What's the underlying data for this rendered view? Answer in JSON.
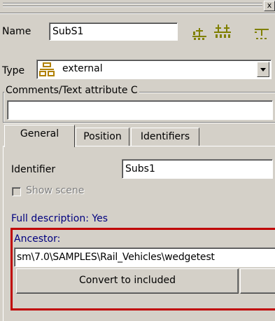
{
  "window": {
    "close_glyph": "x"
  },
  "name_field": {
    "label": "Name",
    "value": "SubS1"
  },
  "toolbar": {
    "icons": [
      "subsystem-up-icon",
      "subsystem-up-down-icon",
      "subsystem-down-icon"
    ],
    "icon_color": "#808000"
  },
  "type_field": {
    "label": "Type",
    "value": "external",
    "icon": "external-type-icon"
  },
  "comments": {
    "legend": "Comments/Text attribute C",
    "value": ""
  },
  "tabs": [
    {
      "label": "General",
      "active": true
    },
    {
      "label": "Position",
      "active": false
    },
    {
      "label": "Identifiers",
      "active": false
    }
  ],
  "general": {
    "identifier_label": "Identifier",
    "identifier_value": "Subs1",
    "show_scene_label": "Show scene",
    "show_scene_checked": false,
    "full_description": "Full description: Yes"
  },
  "ancestor": {
    "label": "Ancestor:",
    "path": "sm\\7.0\\SAMPLES\\Rail_Vehicles\\wedgetest",
    "convert_button": "Convert to included",
    "highlight_color": "#c00000"
  }
}
